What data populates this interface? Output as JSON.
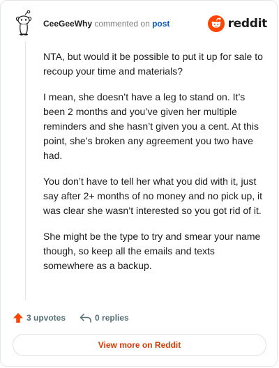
{
  "header": {
    "username": "CeeGeeWhy",
    "action_text": " commented on ",
    "post_link": "post",
    "brand": "reddit"
  },
  "comment": {
    "paragraphs": [
      "NTA, but would it be possible to put it up for sale to recoup your time and materials?",
      "I mean, she doesn’t have a leg to stand on. It’s been 2 months and you’ve given her multiple reminders and she hasn’t given you a cent. At this point, she’s broken any agreement you two have had.",
      "You don’t have to tell her what you did with it, just say after 2+ months of no money and no pick up, it was clear she wasn’t interested so you got rid of it.",
      "She might be the type to try and smear your name though, so keep all the emails and texts somewhere as a backup."
    ]
  },
  "actions": {
    "upvotes": "3 upvotes",
    "replies": "0 replies"
  },
  "footer": {
    "view_more_label": "View more on Reddit"
  },
  "colors": {
    "accent": "#d93900",
    "upvote": "#ff4500",
    "link": "#0a57c2"
  },
  "icons": {
    "avatar": "snoo-avatar-icon",
    "brand": "reddit-logo-icon",
    "upvote": "upvote-arrow-icon",
    "reply": "reply-arrow-icon"
  }
}
